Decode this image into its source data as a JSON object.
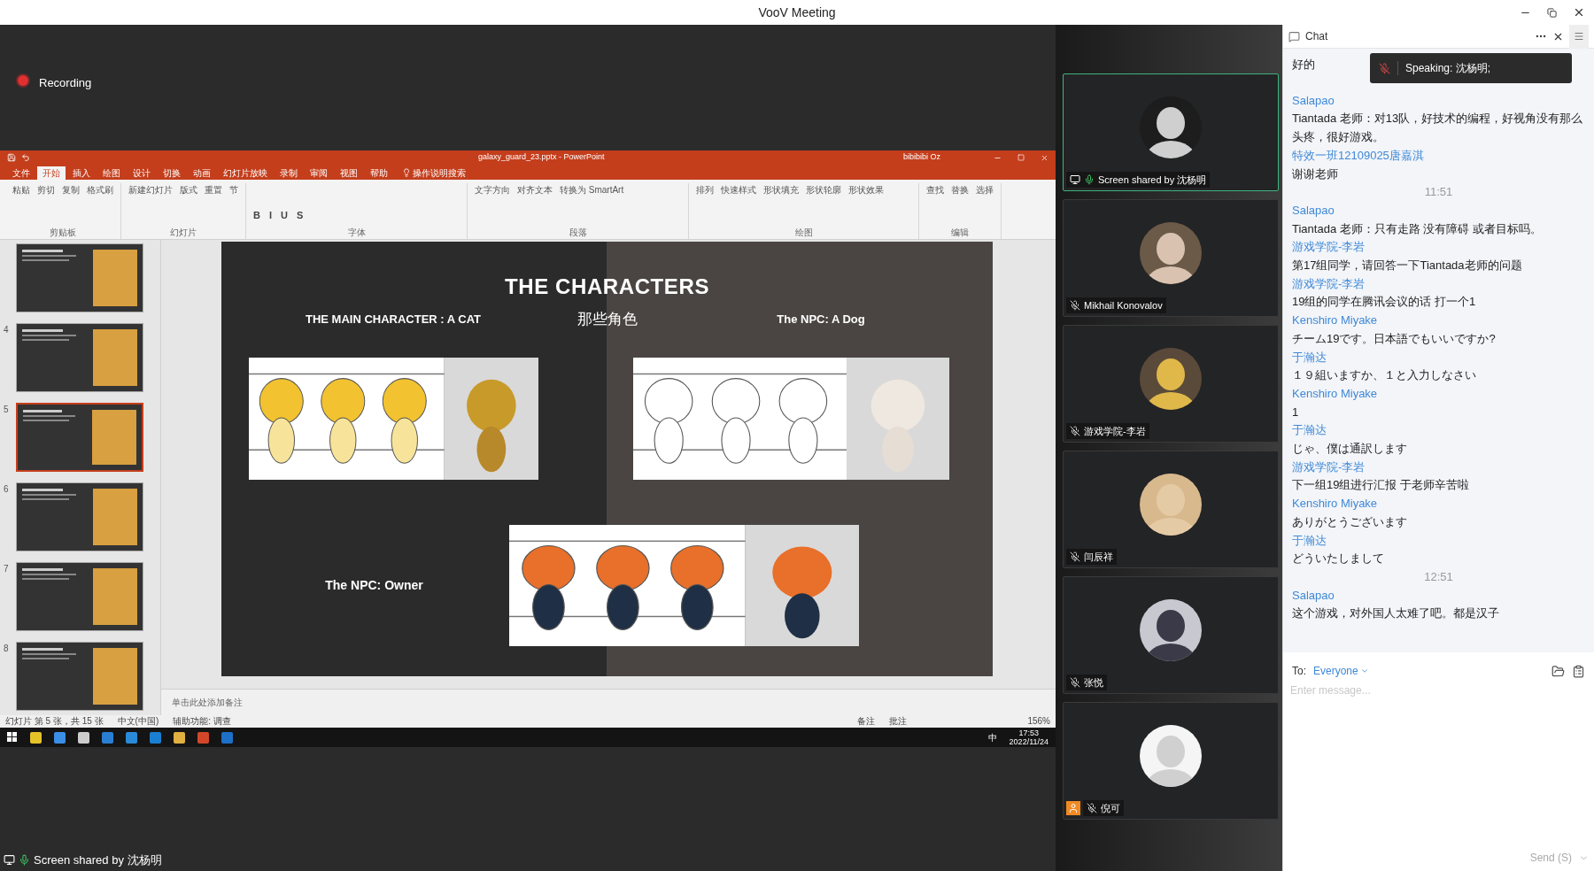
{
  "window": {
    "title": "VooV Meeting"
  },
  "recording": {
    "label": "Recording"
  },
  "powerpoint": {
    "title": "galaxy_guard_23.pptx - PowerPoint",
    "user": "bibibibi Oz",
    "tabs": [
      {
        "label": "文件",
        "selected": false
      },
      {
        "label": "开始",
        "selected": true
      },
      {
        "label": "插入",
        "selected": false
      },
      {
        "label": "绘图",
        "selected": false
      },
      {
        "label": "设计",
        "selected": false
      },
      {
        "label": "切换",
        "selected": false
      },
      {
        "label": "动画",
        "selected": false
      },
      {
        "label": "幻灯片放映",
        "selected": false
      },
      {
        "label": "录制",
        "selected": false
      },
      {
        "label": "审阅",
        "selected": false
      },
      {
        "label": "视图",
        "selected": false
      },
      {
        "label": "帮助",
        "selected": false
      }
    ],
    "tell_me": "操作说明搜索",
    "groups": [
      {
        "label": "剪贴板",
        "buttons": [
          "粘贴",
          "剪切",
          "复制",
          "格式刷"
        ]
      },
      {
        "label": "幻灯片",
        "buttons": [
          "新建幻灯片",
          "版式",
          "重置",
          "节"
        ]
      },
      {
        "label": "字体",
        "buttons": [
          "B",
          "I",
          "U",
          "S"
        ]
      },
      {
        "label": "段落",
        "buttons": [
          "文字方向",
          "对齐文本",
          "转换为 SmartArt"
        ]
      },
      {
        "label": "绘图",
        "buttons": [
          "排列",
          "快速样式",
          "形状填充",
          "形状轮廓",
          "形状效果"
        ]
      },
      {
        "label": "编辑",
        "buttons": [
          "查找",
          "替换",
          "选择"
        ]
      }
    ],
    "thumbnails": [
      {
        "selected": false
      },
      {
        "number": "4",
        "selected": false
      },
      {
        "number": "5",
        "selected": true
      },
      {
        "number": "6",
        "selected": false
      },
      {
        "number": "7",
        "selected": false
      },
      {
        "number": "8",
        "selected": false
      }
    ],
    "slide": {
      "title": "THE CHARACTERS",
      "cat_label": "THE MAIN CHARACTER : A CAT",
      "subtitle": "那些角色",
      "dog_label": "The NPC: A Dog",
      "owner_label": "The NPC: Owner"
    },
    "notes_placeholder": "单击此处添加备注",
    "status_bar": {
      "slide_count": "幻灯片 第 5 张，共 15 张",
      "language": "中文(中国)",
      "accessibility": "辅助功能: 调查",
      "notes": "备注",
      "comments": "批注",
      "zoom": "156%"
    }
  },
  "taskbar": {
    "input_method": "中",
    "time": "17:53",
    "date": "2022/11/24"
  },
  "screen_share_label": "Screen shared by 沈杨明",
  "participants": [
    {
      "name": "Screen shared by 沈杨明",
      "muted": false,
      "sharing": true,
      "active": true,
      "host": false
    },
    {
      "name": "Mikhail Konovalov",
      "muted": true,
      "sharing": false,
      "active": false,
      "host": false
    },
    {
      "name": "游戏学院-李岩",
      "muted": true,
      "sharing": false,
      "active": false,
      "host": false
    },
    {
      "name": "闫辰祥",
      "muted": true,
      "sharing": false,
      "active": false,
      "host": false
    },
    {
      "name": "张悦",
      "muted": true,
      "sharing": false,
      "active": false,
      "host": false
    },
    {
      "name": "倪可",
      "muted": true,
      "sharing": false,
      "active": false,
      "host": true
    }
  ],
  "chat": {
    "title": "Chat",
    "speaking": "Speaking: 沈杨明;",
    "messages": [
      {
        "kind": "message",
        "text": "好的"
      },
      {
        "kind": "message",
        "sender": "Salapao",
        "text": "Tiantada 老师：对13队，好技术的编程，好视角没有那么头疼，很好游戏。"
      },
      {
        "kind": "message",
        "sender": "特效一班12109025唐嘉淇",
        "text": "谢谢老师"
      },
      {
        "kind": "time",
        "text": "11:51"
      },
      {
        "kind": "message",
        "sender": "Salapao",
        "text": "Tiantada 老师：只有走路 没有障碍 或者目标吗。"
      },
      {
        "kind": "message",
        "sender": "游戏学院-李岩",
        "text": "第17组同学，请回答一下Tiantada老师的问题"
      },
      {
        "kind": "message",
        "sender": "游戏学院-李岩",
        "text": "19组的同学在腾讯会议的话 打一个1"
      },
      {
        "kind": "message",
        "sender": "Kenshiro Miyake",
        "text": "チーム19です。日本語でもいいですか?"
      },
      {
        "kind": "message",
        "sender": "于瀚达",
        "text": "１９組いますか、１と入力しなさい"
      },
      {
        "kind": "message",
        "sender": "Kenshiro Miyake",
        "text": "1"
      },
      {
        "kind": "message",
        "sender": "于瀚达",
        "text": "じゃ、僕は通訳します"
      },
      {
        "kind": "message",
        "sender": "游戏学院-李岩",
        "text": "下一组19组进行汇报 于老师辛苦啦"
      },
      {
        "kind": "message",
        "sender": "Kenshiro Miyake",
        "text": "ありがとうございます"
      },
      {
        "kind": "message",
        "sender": "于瀚达",
        "text": "どういたしまして"
      },
      {
        "kind": "time",
        "text": "12:51"
      },
      {
        "kind": "message",
        "sender": "Salapao",
        "text": "这个游戏，对外国人太难了吧。都是汉子"
      }
    ],
    "to_label": "To:",
    "recipient": "Everyone",
    "placeholder": "Enter message...",
    "send": "Send (S)"
  }
}
